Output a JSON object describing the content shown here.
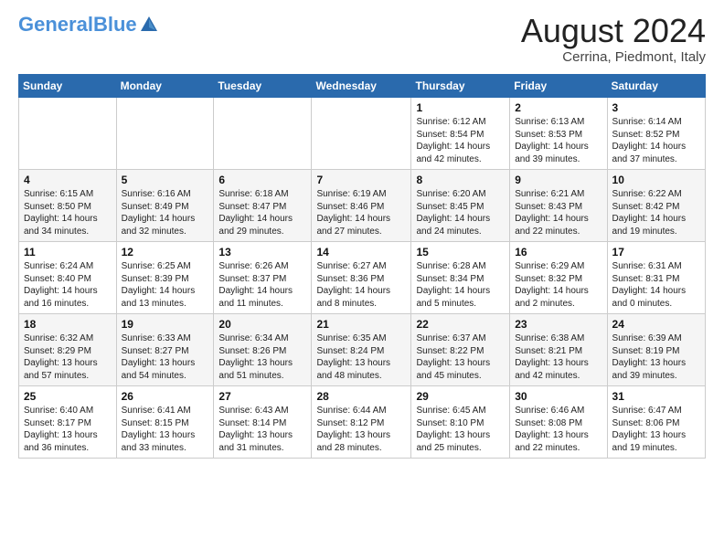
{
  "logo": {
    "text_general": "General",
    "text_blue": "Blue"
  },
  "title": {
    "month_year": "August 2024",
    "location": "Cerrina, Piedmont, Italy"
  },
  "weekdays": [
    "Sunday",
    "Monday",
    "Tuesday",
    "Wednesday",
    "Thursday",
    "Friday",
    "Saturday"
  ],
  "weeks": [
    [
      {
        "day": "",
        "info": ""
      },
      {
        "day": "",
        "info": ""
      },
      {
        "day": "",
        "info": ""
      },
      {
        "day": "",
        "info": ""
      },
      {
        "day": "1",
        "info": "Sunrise: 6:12 AM\nSunset: 8:54 PM\nDaylight: 14 hours\nand 42 minutes."
      },
      {
        "day": "2",
        "info": "Sunrise: 6:13 AM\nSunset: 8:53 PM\nDaylight: 14 hours\nand 39 minutes."
      },
      {
        "day": "3",
        "info": "Sunrise: 6:14 AM\nSunset: 8:52 PM\nDaylight: 14 hours\nand 37 minutes."
      }
    ],
    [
      {
        "day": "4",
        "info": "Sunrise: 6:15 AM\nSunset: 8:50 PM\nDaylight: 14 hours\nand 34 minutes."
      },
      {
        "day": "5",
        "info": "Sunrise: 6:16 AM\nSunset: 8:49 PM\nDaylight: 14 hours\nand 32 minutes."
      },
      {
        "day": "6",
        "info": "Sunrise: 6:18 AM\nSunset: 8:47 PM\nDaylight: 14 hours\nand 29 minutes."
      },
      {
        "day": "7",
        "info": "Sunrise: 6:19 AM\nSunset: 8:46 PM\nDaylight: 14 hours\nand 27 minutes."
      },
      {
        "day": "8",
        "info": "Sunrise: 6:20 AM\nSunset: 8:45 PM\nDaylight: 14 hours\nand 24 minutes."
      },
      {
        "day": "9",
        "info": "Sunrise: 6:21 AM\nSunset: 8:43 PM\nDaylight: 14 hours\nand 22 minutes."
      },
      {
        "day": "10",
        "info": "Sunrise: 6:22 AM\nSunset: 8:42 PM\nDaylight: 14 hours\nand 19 minutes."
      }
    ],
    [
      {
        "day": "11",
        "info": "Sunrise: 6:24 AM\nSunset: 8:40 PM\nDaylight: 14 hours\nand 16 minutes."
      },
      {
        "day": "12",
        "info": "Sunrise: 6:25 AM\nSunset: 8:39 PM\nDaylight: 14 hours\nand 13 minutes."
      },
      {
        "day": "13",
        "info": "Sunrise: 6:26 AM\nSunset: 8:37 PM\nDaylight: 14 hours\nand 11 minutes."
      },
      {
        "day": "14",
        "info": "Sunrise: 6:27 AM\nSunset: 8:36 PM\nDaylight: 14 hours\nand 8 minutes."
      },
      {
        "day": "15",
        "info": "Sunrise: 6:28 AM\nSunset: 8:34 PM\nDaylight: 14 hours\nand 5 minutes."
      },
      {
        "day": "16",
        "info": "Sunrise: 6:29 AM\nSunset: 8:32 PM\nDaylight: 14 hours\nand 2 minutes."
      },
      {
        "day": "17",
        "info": "Sunrise: 6:31 AM\nSunset: 8:31 PM\nDaylight: 14 hours\nand 0 minutes."
      }
    ],
    [
      {
        "day": "18",
        "info": "Sunrise: 6:32 AM\nSunset: 8:29 PM\nDaylight: 13 hours\nand 57 minutes."
      },
      {
        "day": "19",
        "info": "Sunrise: 6:33 AM\nSunset: 8:27 PM\nDaylight: 13 hours\nand 54 minutes."
      },
      {
        "day": "20",
        "info": "Sunrise: 6:34 AM\nSunset: 8:26 PM\nDaylight: 13 hours\nand 51 minutes."
      },
      {
        "day": "21",
        "info": "Sunrise: 6:35 AM\nSunset: 8:24 PM\nDaylight: 13 hours\nand 48 minutes."
      },
      {
        "day": "22",
        "info": "Sunrise: 6:37 AM\nSunset: 8:22 PM\nDaylight: 13 hours\nand 45 minutes."
      },
      {
        "day": "23",
        "info": "Sunrise: 6:38 AM\nSunset: 8:21 PM\nDaylight: 13 hours\nand 42 minutes."
      },
      {
        "day": "24",
        "info": "Sunrise: 6:39 AM\nSunset: 8:19 PM\nDaylight: 13 hours\nand 39 minutes."
      }
    ],
    [
      {
        "day": "25",
        "info": "Sunrise: 6:40 AM\nSunset: 8:17 PM\nDaylight: 13 hours\nand 36 minutes."
      },
      {
        "day": "26",
        "info": "Sunrise: 6:41 AM\nSunset: 8:15 PM\nDaylight: 13 hours\nand 33 minutes."
      },
      {
        "day": "27",
        "info": "Sunrise: 6:43 AM\nSunset: 8:14 PM\nDaylight: 13 hours\nand 31 minutes."
      },
      {
        "day": "28",
        "info": "Sunrise: 6:44 AM\nSunset: 8:12 PM\nDaylight: 13 hours\nand 28 minutes."
      },
      {
        "day": "29",
        "info": "Sunrise: 6:45 AM\nSunset: 8:10 PM\nDaylight: 13 hours\nand 25 minutes."
      },
      {
        "day": "30",
        "info": "Sunrise: 6:46 AM\nSunset: 8:08 PM\nDaylight: 13 hours\nand 22 minutes."
      },
      {
        "day": "31",
        "info": "Sunrise: 6:47 AM\nSunset: 8:06 PM\nDaylight: 13 hours\nand 19 minutes."
      }
    ]
  ]
}
